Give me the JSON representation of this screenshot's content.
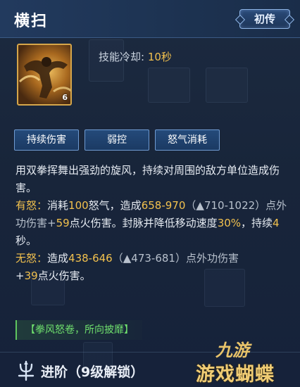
{
  "skill": {
    "name": "横扫",
    "tier": "初传",
    "icon_level": "6",
    "cooldown_label": "技能冷却:",
    "cooldown_value": "10秒"
  },
  "tags": [
    "持续伤害",
    "弱控",
    "怒气消耗"
  ],
  "description": {
    "intro": "用双拳挥舞出强劲的旋风，持续对周围的敌方单位造成伤害。",
    "with_rage": {
      "label": "有怒：",
      "p1": "消耗",
      "cost": "100",
      "p2": "怒气，造成",
      "dmg": "658-970",
      "p3": "（",
      "up_icon": "arrow-up-icon",
      "p4": "710-1022）点外功伤害+",
      "fire": "59",
      "p5": "点火伤害。封脉并降低移动速度",
      "slow": "30%",
      "p6": "，持续",
      "duration": "4",
      "p7": "秒。"
    },
    "no_rage": {
      "label": "无怒：",
      "p1": "造成",
      "dmg": "438-646",
      "p2": "（",
      "up_icon": "arrow-up-icon",
      "p3": "473-681）点外功伤害",
      "fire_prefix": "+",
      "fire": "39",
      "p4": "点火伤害。"
    }
  },
  "sub_effect": "【拳风怒卷，所向披靡】",
  "advance": {
    "icon": "trident-icon",
    "label": "进阶（9级解锁）"
  },
  "watermark": {
    "top": "九游",
    "bottom": "游戏蝴蝶"
  },
  "colors": {
    "gold": "#f2c14e",
    "green": "#69e06a",
    "tag_bg": "#1b3a63",
    "header_bg": "#223a5e"
  }
}
